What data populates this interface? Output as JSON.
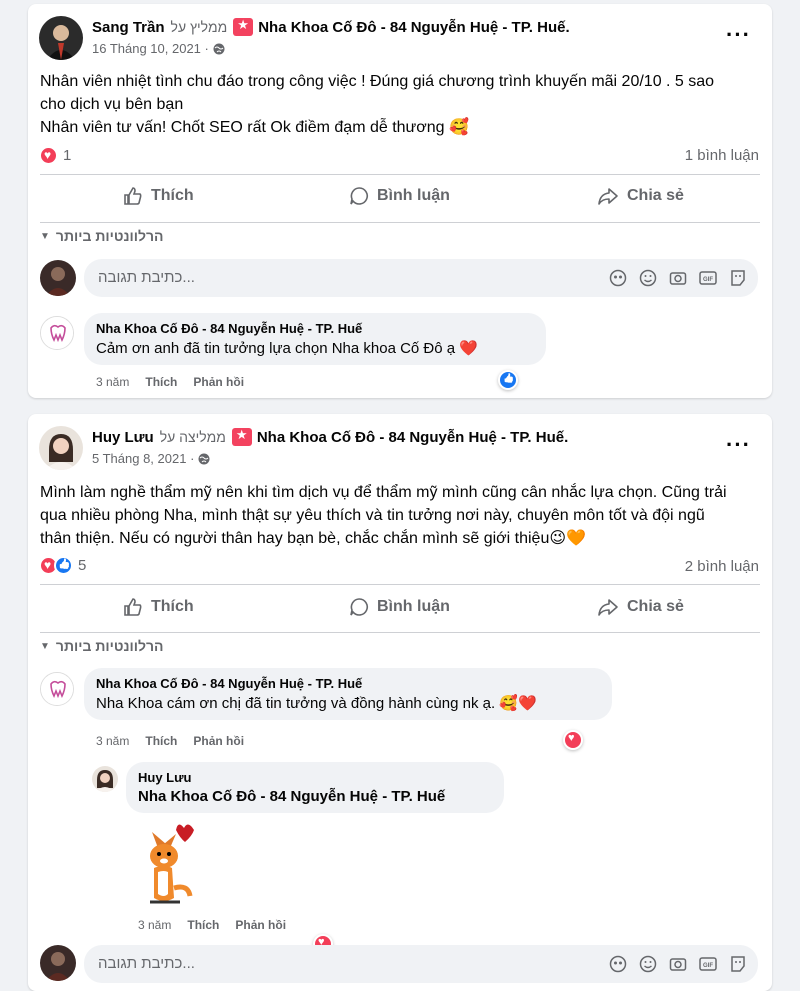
{
  "posts": [
    {
      "author": "Sang Trần",
      "recommends_label": "ממליץ על",
      "page": "Nha Khoa Cố Đô - 84 Nguyễn Huệ - TP. Huế.",
      "date": "16 Tháng 10, 2021 ·",
      "text_lines": [
        "Nhân viên nhiệt tình chu đáo trong công việc ! Đúng giá chương trình khuyến mãi 20/10 . 5 sao",
        "cho dịch vụ bên bạn",
        "Nhân viên tư vấn! Chốt SEO rất Ok điềm đạm dễ thương"
      ],
      "text_emoji": "🥰",
      "reaction_count": "1",
      "comment_count": "1 bình luận",
      "actions": {
        "like": "Thích",
        "comment": "Bình luận",
        "share": "Chia sẻ"
      },
      "sort_label": "הרלוונטיות ביותר",
      "composer_placeholder": "כתיבת תגובה...",
      "comments": [
        {
          "author": "Nha Khoa Cố Đô - 84 Nguyễn Huệ - TP. Huế",
          "text": "Cảm ơn anh đã tin tưởng lựa chọn Nha khoa Cố Đô ạ",
          "text_emoji": "❤️",
          "time": "3 năm",
          "like": "Thích",
          "reply": "Phản hồi",
          "reaction": "like"
        }
      ]
    },
    {
      "author": "Huy Lưu",
      "recommends_label": "ממליצה על",
      "page": "Nha Khoa Cố Đô - 84 Nguyễn Huệ - TP. Huế.",
      "date": "5 Tháng 8, 2021 ·",
      "text_lines": [
        "Mình làm nghề thẩm mỹ nên khi tìm dịch vụ để thẩm mỹ mình cũng cân nhắc lựa chọn. Cũng trải",
        "qua nhiều phòng Nha, mình thật sự yêu thích và tin tưởng nơi này, chuyên môn tốt và đội ngũ",
        "thân thiện. Nếu có người thân hay bạn bè, chắc chắn mình sẽ giới thiệu"
      ],
      "text_emoji": "😉🧡",
      "reaction_count": "5",
      "comment_count": "2 bình luận",
      "actions": {
        "like": "Thích",
        "comment": "Bình luận",
        "share": "Chia sẻ"
      },
      "sort_label": "הרלוונטיות ביותר",
      "composer_placeholder": "כתיבת תגובה...",
      "comments": [
        {
          "author": "Nha Khoa Cố Đô - 84 Nguyễn Huệ - TP. Huế",
          "text": "Nha Khoa cám ơn chị đã tin tưởng và đồng hành cùng nk ạ.",
          "text_emoji": "🥰❤️",
          "time": "3 năm",
          "like": "Thích",
          "reply": "Phản hồi",
          "reaction": "love"
        }
      ],
      "reply": {
        "author": "Huy Lưu",
        "text": "Nha Khoa Cố Đô - 84 Nguyễn Huệ - TP. Huế",
        "time": "3 năm",
        "like": "Thích",
        "reply": "Phản hồi",
        "reaction": "love"
      }
    }
  ]
}
